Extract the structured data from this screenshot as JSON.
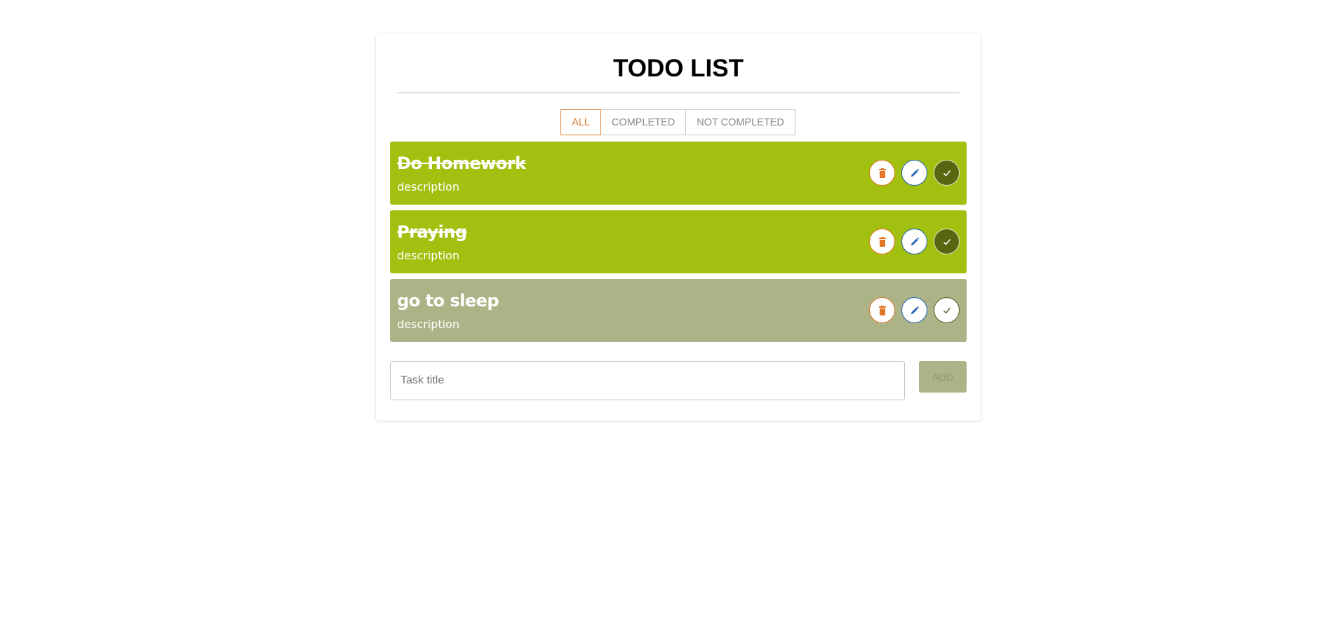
{
  "app": {
    "title": "TODO LIST"
  },
  "filters": [
    {
      "label": "ALL",
      "active": true
    },
    {
      "label": "COMPLETED",
      "active": false
    },
    {
      "label": "NOT COMPLETED",
      "active": false
    }
  ],
  "tasks": [
    {
      "title": "Do Homework",
      "description": "description",
      "completed": true
    },
    {
      "title": "Praying",
      "description": "description",
      "completed": true
    },
    {
      "title": "go to sleep",
      "description": "description",
      "completed": false
    }
  ],
  "task_actions": {
    "delete_icon": "trash-icon",
    "edit_icon": "pencil-icon",
    "complete_icon": "check-icon"
  },
  "add_form": {
    "placeholder": "Task title",
    "value": "",
    "button_label": "ADD"
  },
  "colors": {
    "completed_bg": "#a2c010",
    "pending_bg": "#acb487",
    "accent": "#d87d2c",
    "edit_blue": "#1f5fb5",
    "done_dark": "#5a6510"
  }
}
